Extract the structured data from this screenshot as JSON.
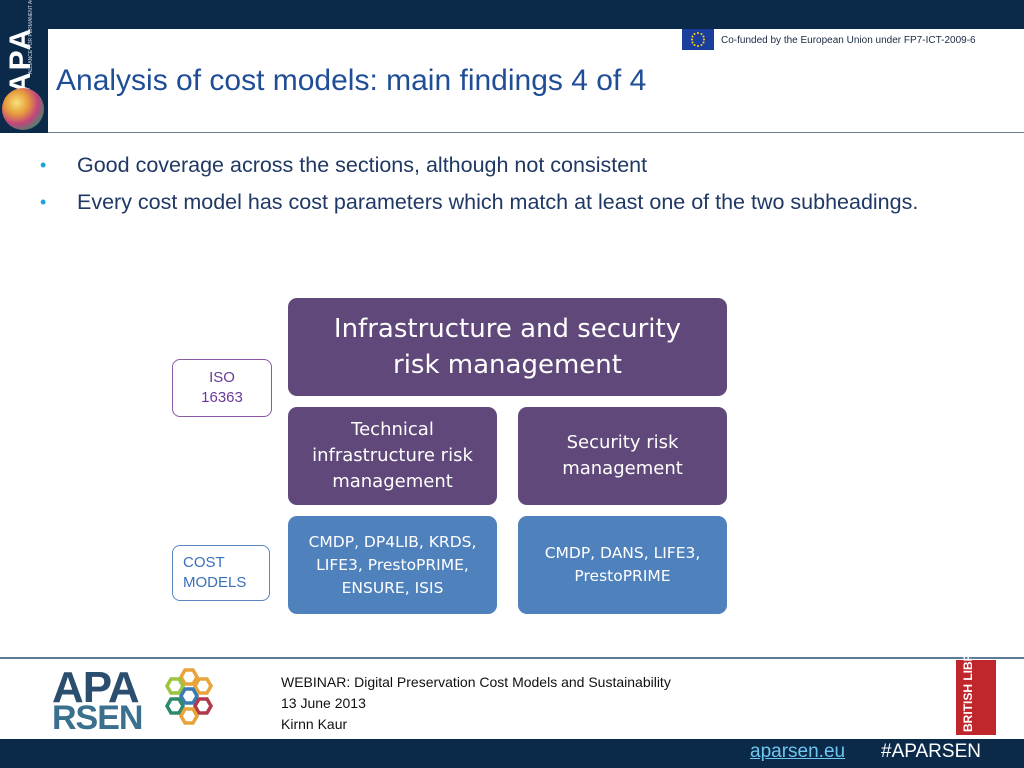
{
  "header": {
    "logo_text": "APA",
    "logo_subtext": "ALLIANCE FOR PERMANENT ACCESS",
    "cofunded": "Co-funded by the European Union under FP7-ICT-2009-6",
    "title": "Analysis of cost models: main findings 4 of 4"
  },
  "bullets": [
    "Good coverage across the sections, although not consistent",
    "Every cost model has cost parameters which match at least one of the two subheadings."
  ],
  "bullet_glyph": "•",
  "diagram": {
    "iso_tag": "ISO 16363",
    "cost_tag": "COST MODELS",
    "top": "Infrastructure and security risk management",
    "left": "Technical infrastructure risk management",
    "right": "Security risk management",
    "left_models": "CMDP, DP4LIB, KRDS, LIFE3, PrestoPRIME, ENSURE, ISIS",
    "right_models": "CMDP, DANS, LIFE3, PrestoPRIME",
    "colors": {
      "purple": "#60497a",
      "blue": "#4f81bd"
    }
  },
  "footer": {
    "logo_apa": "APA",
    "logo_rsen": "RSEN",
    "webinar": "WEBINAR: Digital Preservation Cost Models and Sustainability",
    "date": "13 June 2013",
    "author": "Kirnn Kaur",
    "bl_logo": "BRITISH LIBRARY",
    "link": "aparsen.eu",
    "hashtag": "#APARSEN"
  }
}
